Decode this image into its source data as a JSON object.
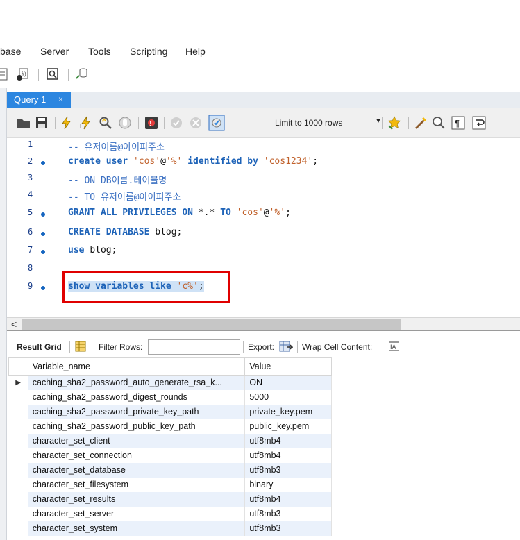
{
  "menu": [
    "base",
    "Server",
    "Tools",
    "Scripting",
    "Help"
  ],
  "tab": {
    "label": "Query 1",
    "close": "×"
  },
  "editor_toolbar": {
    "limit_label": "Limit to 1000 rows"
  },
  "editor": {
    "lines": [
      {
        "num": "1",
        "dot": false
      },
      {
        "num": "2",
        "dot": true
      },
      {
        "num": "3",
        "dot": false
      },
      {
        "num": "4",
        "dot": false
      },
      {
        "num": "5",
        "dot": true
      },
      {
        "num": "6",
        "dot": true
      },
      {
        "num": "7",
        "dot": true
      },
      {
        "num": "8",
        "dot": false
      },
      {
        "num": "9",
        "dot": true
      }
    ],
    "code": {
      "l1_comment": "-- 유저이름@아이피주소",
      "l2_kw1": "create user ",
      "l2_str1": "'cos'",
      "l2_at": "@",
      "l2_str2": "'%'",
      "l2_kw2": " identified by ",
      "l2_str3": "'cos1234'",
      "l2_end": ";",
      "l3_comment": "-- ON DB이름.테이블명",
      "l4_comment": "-- TO 유저이름@아이피주소",
      "l5_kw": "GRANT ALL PRIVILEGES ON ",
      "l5_plain": "*.* ",
      "l5_kw2": "TO ",
      "l5_str1": "'cos'",
      "l5_at": "@",
      "l5_str2": "'%'",
      "l5_end": ";",
      "l6_kw": "CREATE DATABASE ",
      "l6_plain": "blog;",
      "l7_kw": "use ",
      "l7_plain": "blog;",
      "l9_kw": "show variables like ",
      "l9_str": "'c%'",
      "l9_end": ";"
    }
  },
  "results_toolbar": {
    "result_grid": "Result Grid",
    "filter_rows": "Filter Rows:",
    "export": "Export:",
    "wrap": "Wrap Cell Content:"
  },
  "grid": {
    "headers": [
      "Variable_name",
      "Value"
    ],
    "rows": [
      [
        "caching_sha2_password_auto_generate_rsa_k...",
        "ON"
      ],
      [
        "caching_sha2_password_digest_rounds",
        "5000"
      ],
      [
        "caching_sha2_password_private_key_path",
        "private_key.pem"
      ],
      [
        "caching_sha2_password_public_key_path",
        "public_key.pem"
      ],
      [
        "character_set_client",
        "utf8mb4"
      ],
      [
        "character_set_connection",
        "utf8mb4"
      ],
      [
        "character_set_database",
        "utf8mb3"
      ],
      [
        "character_set_filesystem",
        "binary"
      ],
      [
        "character_set_results",
        "utf8mb4"
      ],
      [
        "character_set_server",
        "utf8mb3"
      ],
      [
        "character_set_system",
        "utf8mb3"
      ]
    ],
    "selected_marker": "▶"
  },
  "colors": {
    "tab_active": "#2c86e0",
    "keyword": "#1e63b8",
    "string": "#c0602a",
    "highlight_box": "#e00000",
    "row_alt": "#eaf1fb"
  }
}
